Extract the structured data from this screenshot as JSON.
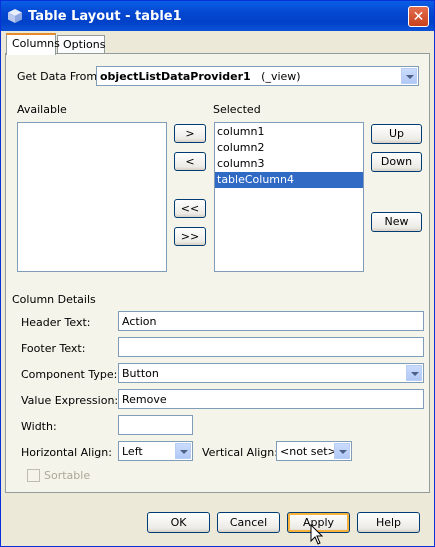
{
  "window": {
    "title": "Table Layout - table1",
    "close_glyph": "✕"
  },
  "tabs": [
    {
      "label": "Columns"
    },
    {
      "label": "Options"
    }
  ],
  "get_data": {
    "label": "Get Data From:",
    "value_bold": "objectListDataProvider1",
    "value_suffix": "(_view)"
  },
  "available": {
    "label": "Available",
    "items": []
  },
  "selected": {
    "label": "Selected",
    "items": [
      "column1",
      "column2",
      "column3",
      "tableColumn4"
    ],
    "selected_index": 3
  },
  "move_buttons": {
    "add": ">",
    "remove": "<",
    "remove_all": "<<",
    "add_all": ">>"
  },
  "order_buttons": {
    "up": "Up",
    "down": "Down",
    "new": "New"
  },
  "details": {
    "section_label": "Column Details",
    "header_text": {
      "label": "Header Text:",
      "value": "Action"
    },
    "footer_text": {
      "label": "Footer Text:",
      "value": ""
    },
    "component_type": {
      "label": "Component Type:",
      "value": "Button"
    },
    "value_expression": {
      "label": "Value Expression:",
      "value": "Remove"
    },
    "width": {
      "label": "Width:",
      "value": ""
    },
    "horizontal_align": {
      "label": "Horizontal Align:",
      "value": "Left"
    },
    "vertical_align": {
      "label": "Vertical Align:",
      "value": "<not set>"
    },
    "sortable": {
      "label": "Sortable",
      "checked": false
    }
  },
  "footer_buttons": {
    "ok": "OK",
    "cancel": "Cancel",
    "apply": "Apply",
    "help": "Help"
  }
}
